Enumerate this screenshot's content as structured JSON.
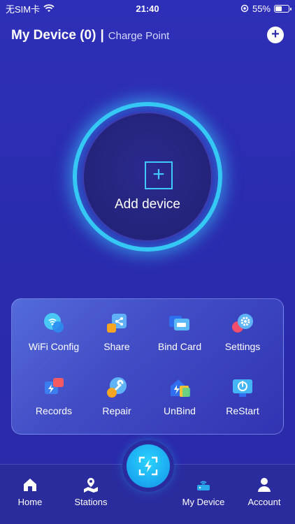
{
  "status": {
    "carrier": "无SIM卡",
    "time": "21:40",
    "battery": "55%",
    "battery_level": 0.55
  },
  "header": {
    "title": "My Device (0)",
    "separator": "|",
    "subtitle": "Charge Point",
    "add_label": "+"
  },
  "main": {
    "add_device_label": "Add device",
    "plus_glyph": "+"
  },
  "actions": [
    {
      "label": "WiFi Config",
      "icon": "wifi-icon"
    },
    {
      "label": "Share",
      "icon": "share-icon"
    },
    {
      "label": "Bind  Card",
      "icon": "card-icon"
    },
    {
      "label": "Settings",
      "icon": "gear-icon"
    },
    {
      "label": "Records",
      "icon": "records-icon"
    },
    {
      "label": "Repair",
      "icon": "wrench-icon"
    },
    {
      "label": "UnBind",
      "icon": "unbind-icon"
    },
    {
      "label": "ReStart",
      "icon": "power-icon"
    }
  ],
  "tabs": [
    {
      "label": "Home",
      "icon": "home-icon"
    },
    {
      "label": "Stations",
      "icon": "map-pin-icon"
    },
    {
      "label": "My Device",
      "icon": "router-icon",
      "active": true
    },
    {
      "label": "Account",
      "icon": "user-icon"
    }
  ],
  "colors": {
    "accent": "#35c8f5",
    "background": "#2e2fb8"
  }
}
